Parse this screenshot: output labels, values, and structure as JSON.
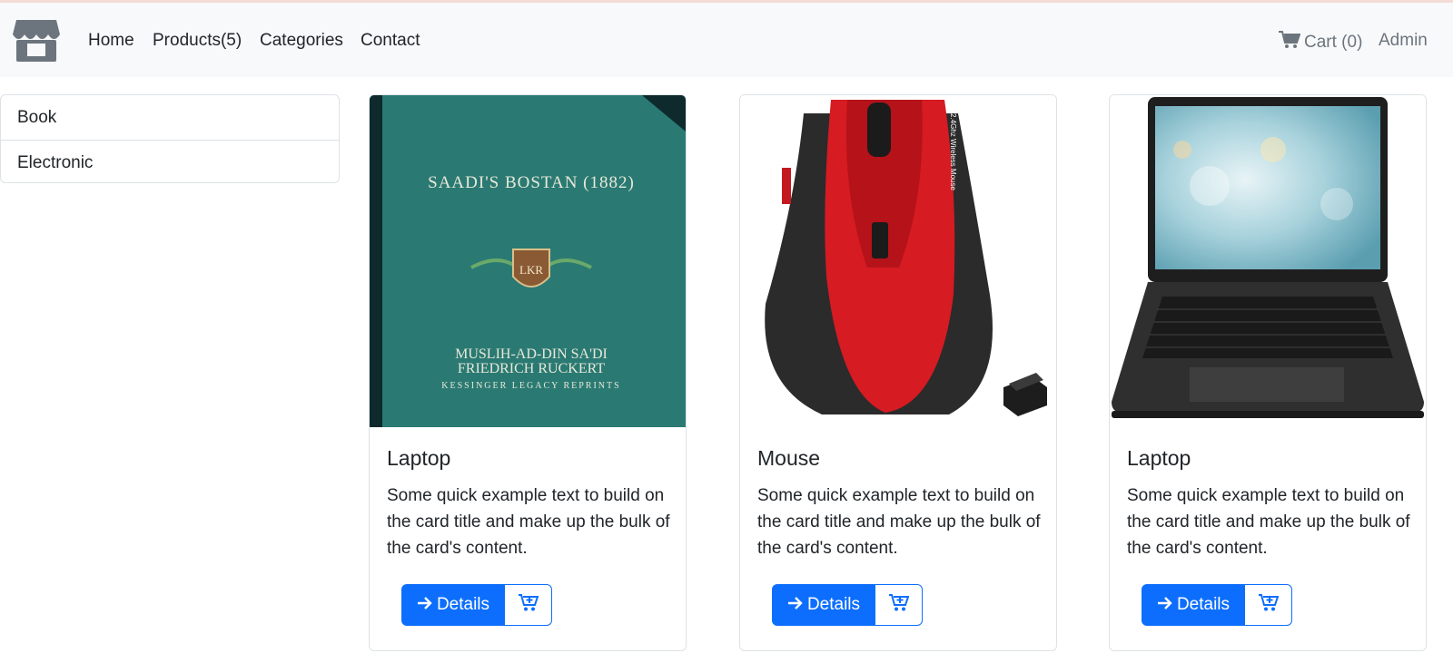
{
  "nav": {
    "links": [
      "Home",
      "Products(5)",
      "Categories",
      "Contact"
    ],
    "cart_label": "Cart (0)",
    "admin_label": "Admin"
  },
  "sidebar": {
    "items": [
      "Book",
      "Electronic"
    ]
  },
  "products": [
    {
      "title": "Laptop",
      "text": "Some quick example text to build on the card title and make up the bulk of the card's content.",
      "details_label": "Details",
      "image": {
        "book_title": "SAADI'S BOSTAN (1882)",
        "author1": "MUSLIH-AD-DIN SA'DI",
        "author2": "FRIEDRICH RUCKERT",
        "publisher": "KESSINGER LEGACY REPRINTS",
        "emblem": "LKR"
      }
    },
    {
      "title": "Mouse",
      "text": "Some quick example text to build on the card title and make up the bulk of the card's content.",
      "details_label": "Details",
      "image": {
        "side_print": "2.4Ghz Wireless Mouse"
      }
    },
    {
      "title": "Laptop",
      "text": "Some quick example text to build on the card title and make up the bulk of the card's content.",
      "details_label": "Details"
    }
  ],
  "colors": {
    "primary": "#0d6efd",
    "navbar_bg": "#f8f9fa",
    "muted": "#6c757d",
    "book_cover": "#2a7a73",
    "mouse_red": "#d61b22"
  },
  "icons": [
    "store-icon",
    "cart-icon",
    "arrow-right-icon",
    "cart-plus-icon"
  ]
}
